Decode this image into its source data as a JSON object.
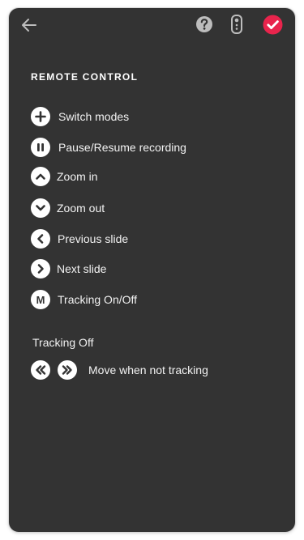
{
  "colors": {
    "panel_bg": "#333333",
    "icon_fg": "#ffffff",
    "accent": "#e8244c"
  },
  "toolbar": {
    "back_icon": "arrow-left-icon",
    "help_icon": "question-circle-icon",
    "remote_icon": "remote-control-icon",
    "done_icon": "check-circle-icon"
  },
  "section": {
    "title": "REMOTE CONTROL"
  },
  "controls": [
    {
      "icon": "plus-icon",
      "label": "Switch modes"
    },
    {
      "icon": "pause-icon",
      "label": "Pause/Resume recording"
    },
    {
      "icon": "chevron-up-icon",
      "label": "Zoom in"
    },
    {
      "icon": "chevron-down-icon",
      "label": "Zoom out"
    },
    {
      "icon": "chevron-left-icon",
      "label": "Previous slide"
    },
    {
      "icon": "chevron-right-icon",
      "label": "Next slide"
    },
    {
      "icon": "m-icon",
      "letter": "M",
      "label": "Tracking On/Off"
    }
  ],
  "tracking_off": {
    "title": "Tracking Off",
    "icons": [
      "double-chevron-left-icon",
      "double-chevron-right-icon"
    ],
    "label": "Move when not tracking"
  }
}
